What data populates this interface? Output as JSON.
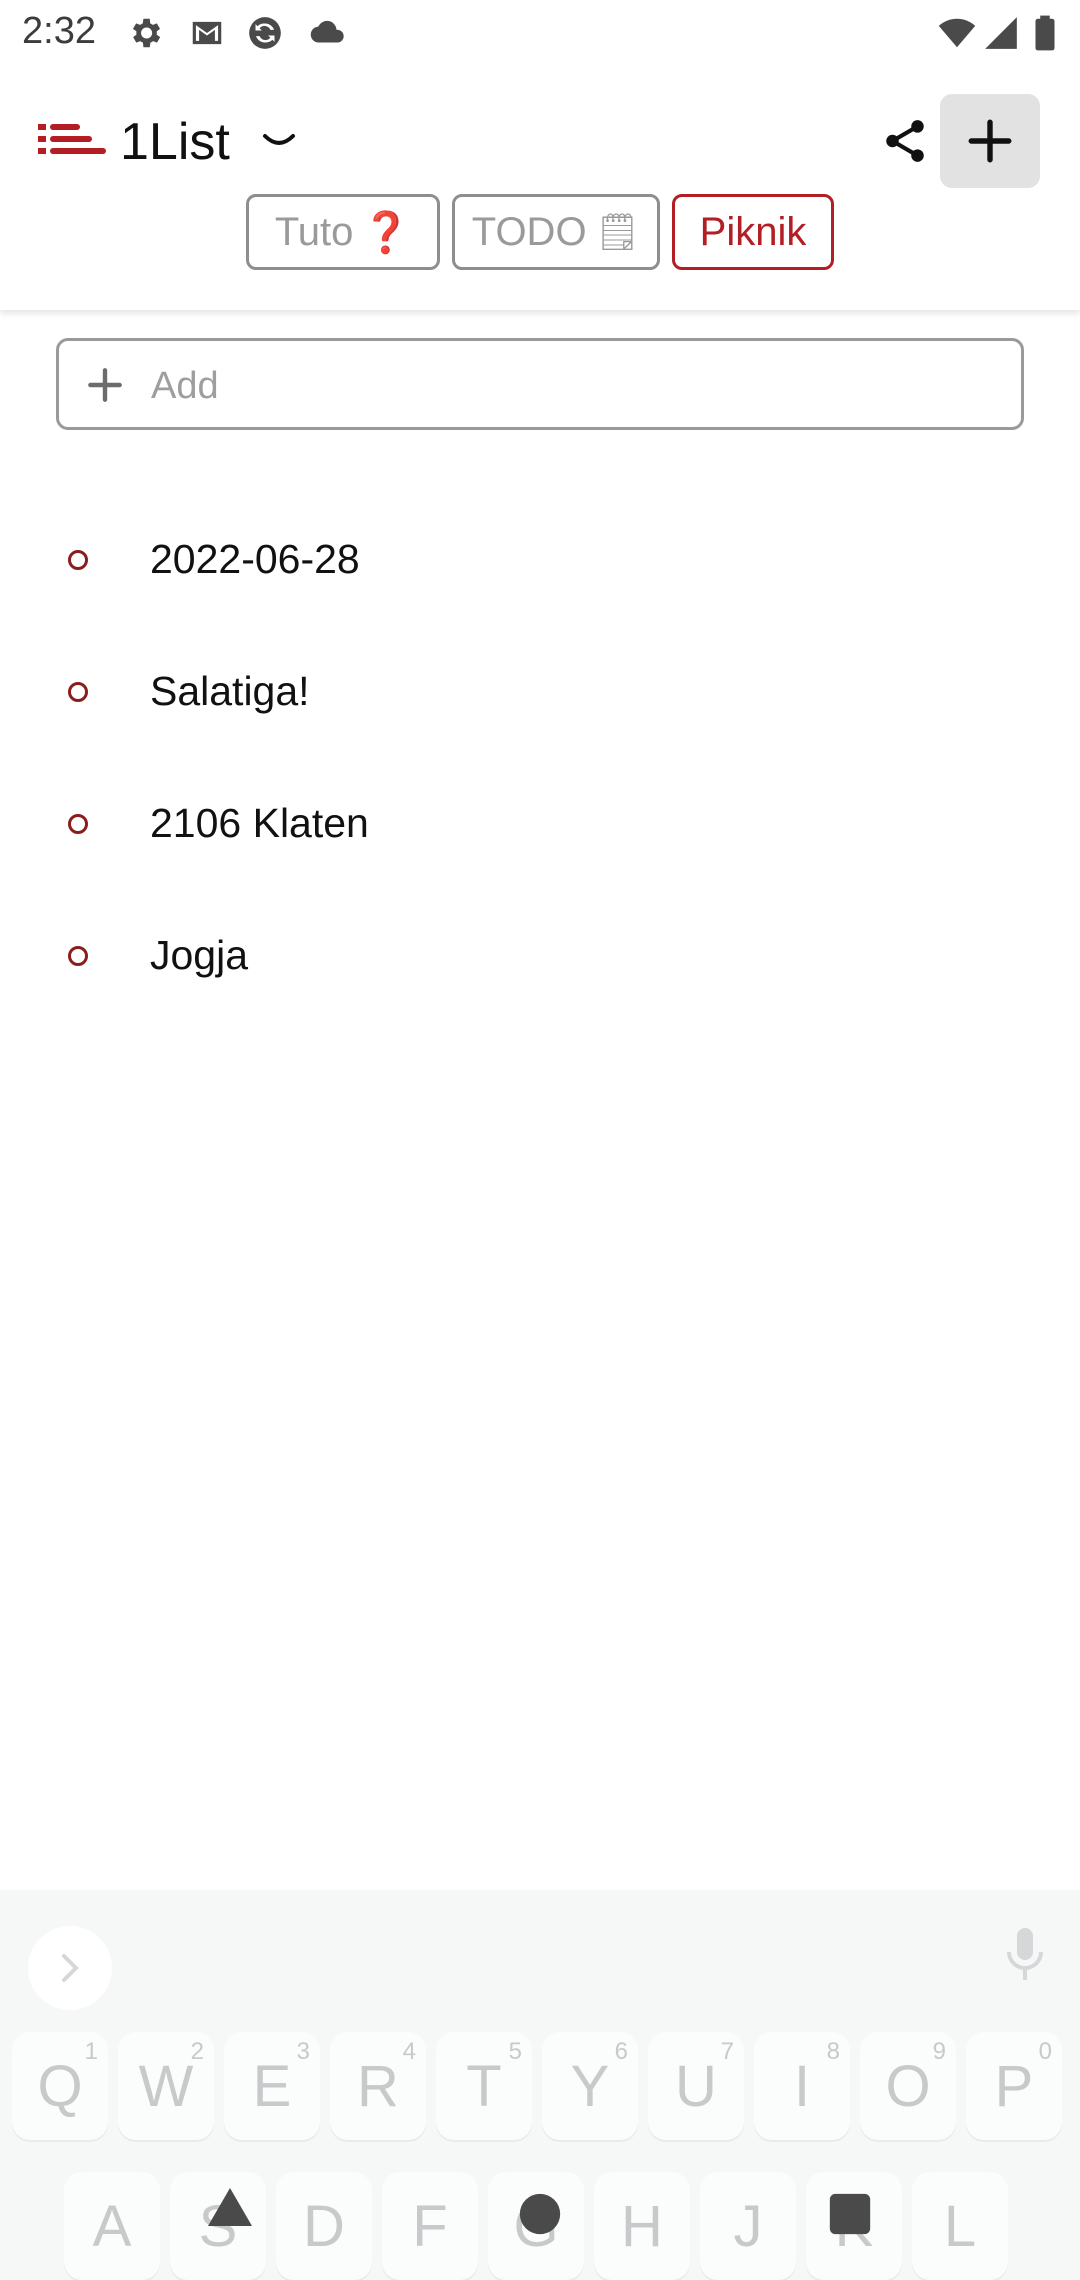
{
  "status": {
    "time": "2:32",
    "left_icons": [
      "settings-gear-icon",
      "gmail-icon",
      "sync-app-icon",
      "cloud-icon"
    ],
    "right_icons": [
      "wifi-icon",
      "signal-icon",
      "battery-icon"
    ]
  },
  "app": {
    "title": "1List",
    "logo_color": "#b21e23",
    "actions": [
      "share-icon",
      "add-icon"
    ]
  },
  "tabs": [
    {
      "label": "Tuto",
      "emoji": "❓",
      "active": false
    },
    {
      "label": "TODO",
      "emoji": "🗒",
      "active": false
    },
    {
      "label": "Piknik",
      "emoji": "",
      "active": true
    }
  ],
  "add_field": {
    "placeholder": "Add"
  },
  "items": [
    {
      "text": "2022-06-28"
    },
    {
      "text": "Salatiga!"
    },
    {
      "text": "2106 Klaten"
    },
    {
      "text": "Jogja"
    }
  ],
  "keyboard": {
    "row1": [
      {
        "key": "Q",
        "num": "1"
      },
      {
        "key": "W",
        "num": "2"
      },
      {
        "key": "E",
        "num": "3"
      },
      {
        "key": "R",
        "num": "4"
      },
      {
        "key": "T",
        "num": "5"
      },
      {
        "key": "Y",
        "num": "6"
      },
      {
        "key": "U",
        "num": "7"
      },
      {
        "key": "I",
        "num": "8"
      },
      {
        "key": "O",
        "num": "9"
      },
      {
        "key": "P",
        "num": "0"
      }
    ],
    "row2": [
      "A",
      "S",
      "D",
      "F",
      "G",
      "H",
      "J",
      "K",
      "L"
    ]
  },
  "colors": {
    "accent": "#b21e23",
    "bullet": "#8b1d1d"
  }
}
